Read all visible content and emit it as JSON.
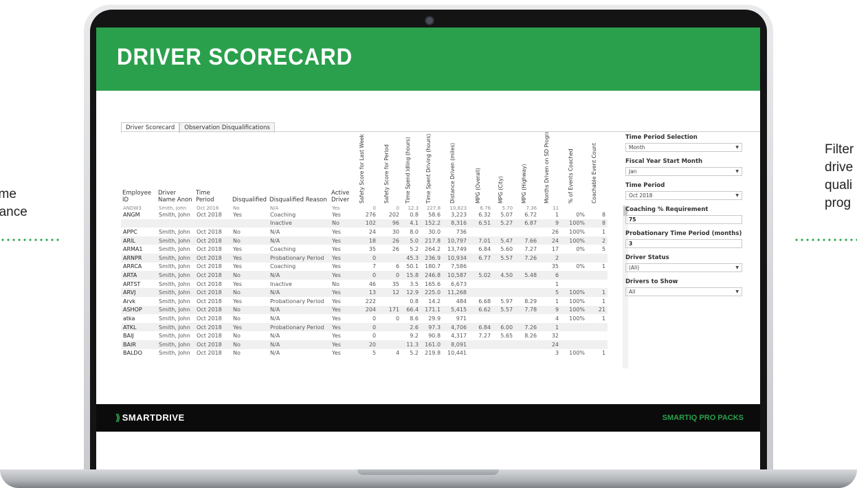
{
  "side_captions": {
    "left": [
      "time",
      "nance"
    ],
    "right": [
      "Filter",
      "drive",
      "quali",
      "prog"
    ]
  },
  "colors": {
    "brand_green": "#2aa04c",
    "footer_black": "#0b0b0b"
  },
  "dashboard": {
    "title": "DRIVER SCORECARD",
    "tabs": [
      "Driver Scorecard",
      "Observation Disqualifications"
    ],
    "columns": [
      "Employee ID",
      "Driver Name Anon",
      "Time Period",
      "Disqualified",
      "Disqualified Reason",
      "Active Driver",
      "Safety Score for Last Week in Period",
      "Safety Score for Period",
      "Time Spend Idling (hours)",
      "Time Spent Driving (hours)",
      "Distance Driven (miles)",
      "MPG (Overall)",
      "MPG (City)",
      "MPG (Highway)",
      "Months Driven on SD Program",
      "% of Events Coached",
      "Coachable Event Count"
    ],
    "partial_row": [
      "ANDW3",
      "Smith, John",
      "Oct 2018",
      "No",
      "N/A",
      "Yes",
      "0",
      "0",
      "12.3",
      "227.8",
      "10,823",
      "6.76",
      "5.70",
      "7.36",
      "11",
      "",
      ""
    ],
    "rows": [
      [
        "ANGM",
        "Smith, John",
        "Oct 2018",
        "Yes",
        "Coaching",
        "Yes",
        "276",
        "202",
        "0.8",
        "58.6",
        "3,223",
        "6.32",
        "5.07",
        "6.72",
        "1",
        "0%",
        "8"
      ],
      [
        "",
        "",
        "",
        "",
        "Inactive",
        "No",
        "102",
        "96",
        "4.1",
        "152.2",
        "8,316",
        "6.51",
        "5.27",
        "6.87",
        "9",
        "100%",
        "8"
      ],
      [
        "APPC",
        "Smith, John",
        "Oct 2018",
        "No",
        "N/A",
        "Yes",
        "24",
        "30",
        "8.0",
        "30.0",
        "736",
        "",
        "",
        "",
        "26",
        "100%",
        "1"
      ],
      [
        "ARIL",
        "Smith, John",
        "Oct 2018",
        "No",
        "N/A",
        "Yes",
        "18",
        "26",
        "5.0",
        "217.8",
        "10,797",
        "7.01",
        "5.47",
        "7.66",
        "24",
        "100%",
        "2"
      ],
      [
        "ARMA1",
        "Smith, John",
        "Oct 2018",
        "Yes",
        "Coaching",
        "Yes",
        "35",
        "26",
        "5.2",
        "264.2",
        "13,749",
        "6.84",
        "5.60",
        "7.27",
        "17",
        "0%",
        "5"
      ],
      [
        "ARNPR",
        "Smith, John",
        "Oct 2018",
        "Yes",
        "Probationary Period",
        "Yes",
        "0",
        "",
        "45.3",
        "236.9",
        "10,934",
        "6.77",
        "5.57",
        "7.26",
        "2",
        "",
        ""
      ],
      [
        "ARRCA",
        "Smith, John",
        "Oct 2018",
        "Yes",
        "Coaching",
        "Yes",
        "7",
        "6",
        "50.1",
        "180.7",
        "7,586",
        "",
        "",
        "",
        "35",
        "0%",
        "1"
      ],
      [
        "ARTA",
        "Smith, John",
        "Oct 2018",
        "No",
        "N/A",
        "Yes",
        "0",
        "0",
        "15.8",
        "246.8",
        "10,587",
        "5.02",
        "4.50",
        "5.48",
        "6",
        "",
        ""
      ],
      [
        "ARTST",
        "Smith, John",
        "Oct 2018",
        "Yes",
        "Inactive",
        "No",
        "46",
        "35",
        "3.5",
        "165.6",
        "6,673",
        "",
        "",
        "",
        "1",
        "",
        ""
      ],
      [
        "ARVJ",
        "Smith, John",
        "Oct 2018",
        "No",
        "N/A",
        "Yes",
        "13",
        "12",
        "12.9",
        "225.0",
        "11,268",
        "",
        "",
        "",
        "5",
        "100%",
        "1"
      ],
      [
        "Arvk",
        "Smith, John",
        "Oct 2018",
        "Yes",
        "Probationary Period",
        "Yes",
        "222",
        "",
        "0.8",
        "14.2",
        "484",
        "6.68",
        "5.97",
        "8.29",
        "1",
        "100%",
        "1"
      ],
      [
        "ASHOP",
        "Smith, John",
        "Oct 2018",
        "No",
        "N/A",
        "Yes",
        "204",
        "171",
        "66.4",
        "171.1",
        "5,415",
        "6.62",
        "5.57",
        "7.78",
        "9",
        "100%",
        "21"
      ],
      [
        "atka",
        "Smith, John",
        "Oct 2018",
        "No",
        "N/A",
        "Yes",
        "0",
        "0",
        "8.6",
        "29.9",
        "971",
        "",
        "",
        "",
        "4",
        "100%",
        "1"
      ],
      [
        "ATKL",
        "Smith, John",
        "Oct 2018",
        "Yes",
        "Probationary Period",
        "Yes",
        "0",
        "",
        "2.6",
        "97.3",
        "4,706",
        "6.84",
        "6.00",
        "7.26",
        "1",
        "",
        ""
      ],
      [
        "BAIJ",
        "Smith, John",
        "Oct 2018",
        "No",
        "N/A",
        "Yes",
        "0",
        "",
        "9.2",
        "90.8",
        "4,317",
        "7.27",
        "5.65",
        "8.26",
        "32",
        "",
        ""
      ],
      [
        "BAIR",
        "Smith, John",
        "Oct 2018",
        "No",
        "N/A",
        "Yes",
        "20",
        "",
        "11.3",
        "161.0",
        "8,091",
        "",
        "",
        "",
        "24",
        "",
        ""
      ],
      [
        "BALDO",
        "Smith, John",
        "Oct 2018",
        "No",
        "N/A",
        "Yes",
        "5",
        "4",
        "5.2",
        "219.8",
        "10,441",
        "",
        "",
        "",
        "3",
        "100%",
        "1"
      ]
    ]
  },
  "filters": {
    "time_period_selection": {
      "label": "Time Period Selection",
      "value": "Month"
    },
    "fiscal_year_start": {
      "label": "Fiscal Year Start Month",
      "value": "Jan"
    },
    "time_period": {
      "label": "Time Period",
      "value": "Oct 2018"
    },
    "coaching_req": {
      "label": "Coaching % Requirement",
      "value": "75"
    },
    "probationary": {
      "label": "Probationary Time Period (months)",
      "value": "3"
    },
    "driver_status": {
      "label": "Driver Status",
      "value": "(All)"
    },
    "drivers_to_show": {
      "label": "Drivers to Show",
      "value": "All"
    }
  },
  "footer": {
    "logo": "SMARTDRIVE",
    "logo_icon": "smartdrive-swoosh-icon",
    "product": "SMARTIQ PRO PACKS"
  }
}
